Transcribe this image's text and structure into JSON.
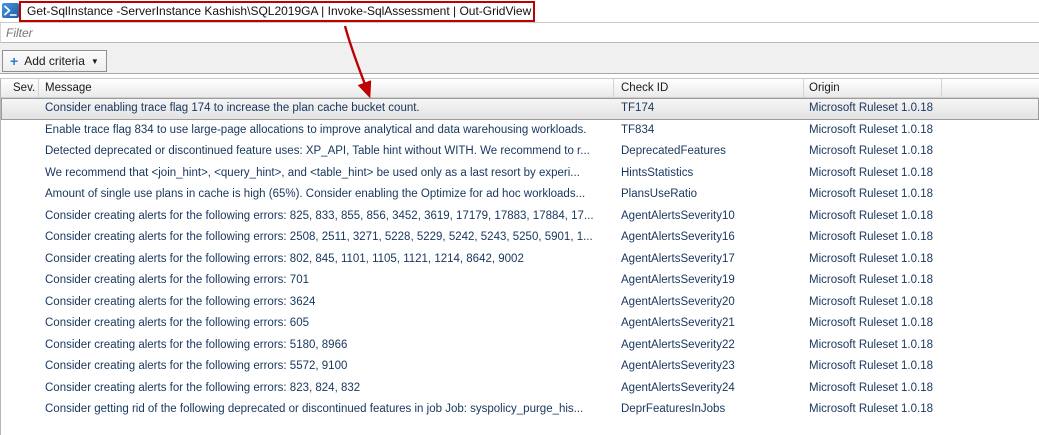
{
  "window": {
    "command": "Get-SqlInstance -ServerInstance Kashish\\SQL2019GA | Invoke-SqlAssessment  | Out-GridView"
  },
  "filter": {
    "placeholder": "Filter",
    "value": ""
  },
  "toolbar": {
    "add_criteria_label": "Add criteria",
    "plus_glyph": "+",
    "caret_glyph": "▼"
  },
  "grid": {
    "columns": [
      {
        "key": "sev",
        "label": "Sev."
      },
      {
        "key": "message",
        "label": "Message"
      },
      {
        "key": "check_id",
        "label": "Check ID"
      },
      {
        "key": "origin",
        "label": "Origin"
      },
      {
        "key": "extra",
        "label": ""
      }
    ],
    "selected_index": 0,
    "rows": [
      {
        "sev": "",
        "message": "Consider enabling trace flag 174 to increase the plan cache bucket count.",
        "check_id": "TF174",
        "origin": "Microsoft Ruleset 1.0.18"
      },
      {
        "sev": "",
        "message": "Enable trace flag 834 to use large-page allocations to improve analytical and data warehousing workloads.",
        "check_id": "TF834",
        "origin": "Microsoft Ruleset 1.0.18"
      },
      {
        "sev": "",
        "message": "Detected deprecated or discontinued feature uses: XP_API, Table hint without WITH. We recommend to r...",
        "check_id": "DeprecatedFeatures",
        "origin": "Microsoft Ruleset 1.0.18"
      },
      {
        "sev": "",
        "message": "We recommend that <join_hint>, <query_hint>, and <table_hint> be used only as a last resort by experi...",
        "check_id": "HintsStatistics",
        "origin": "Microsoft Ruleset 1.0.18"
      },
      {
        "sev": "",
        "message": "Amount of single use plans in cache is high (65%). Consider enabling the Optimize for ad hoc workloads...",
        "check_id": "PlansUseRatio",
        "origin": "Microsoft Ruleset 1.0.18"
      },
      {
        "sev": "",
        "message": "Consider creating alerts for the following errors: 825, 833, 855, 856, 3452, 3619, 17179, 17883, 17884, 17...",
        "check_id": "AgentAlertsSeverity10",
        "origin": "Microsoft Ruleset 1.0.18"
      },
      {
        "sev": "",
        "message": "Consider creating alerts for the following errors: 2508, 2511, 3271, 5228, 5229, 5242, 5243, 5250, 5901, 1...",
        "check_id": "AgentAlertsSeverity16",
        "origin": "Microsoft Ruleset 1.0.18"
      },
      {
        "sev": "",
        "message": "Consider creating alerts for the following errors: 802, 845, 1101, 1105, 1121, 1214, 8642, 9002",
        "check_id": "AgentAlertsSeverity17",
        "origin": "Microsoft Ruleset 1.0.18"
      },
      {
        "sev": "",
        "message": "Consider creating alerts for the following errors: 701",
        "check_id": "AgentAlertsSeverity19",
        "origin": "Microsoft Ruleset 1.0.18"
      },
      {
        "sev": "",
        "message": "Consider creating alerts for the following errors: 3624",
        "check_id": "AgentAlertsSeverity20",
        "origin": "Microsoft Ruleset 1.0.18"
      },
      {
        "sev": "",
        "message": "Consider creating alerts for the following errors: 605",
        "check_id": "AgentAlertsSeverity21",
        "origin": "Microsoft Ruleset 1.0.18"
      },
      {
        "sev": "",
        "message": "Consider creating alerts for the following errors: 5180, 8966",
        "check_id": "AgentAlertsSeverity22",
        "origin": "Microsoft Ruleset 1.0.18"
      },
      {
        "sev": "",
        "message": "Consider creating alerts for the following errors: 5572, 9100",
        "check_id": "AgentAlertsSeverity23",
        "origin": "Microsoft Ruleset 1.0.18"
      },
      {
        "sev": "",
        "message": "Consider creating alerts for the following errors: 823, 824, 832",
        "check_id": "AgentAlertsSeverity24",
        "origin": "Microsoft Ruleset 1.0.18"
      },
      {
        "sev": "",
        "message": "Consider getting rid of the following deprecated or discontinued features in job Job: syspolicy_purge_his...",
        "check_id": "DeprFeaturesInJobs",
        "origin": "Microsoft Ruleset 1.0.18"
      }
    ]
  },
  "colors": {
    "annotation_red": "#be0000",
    "row_text": "#17365d",
    "powershell_blue": "#2e76c0",
    "toolbar_bg": "#f0f0f0"
  }
}
